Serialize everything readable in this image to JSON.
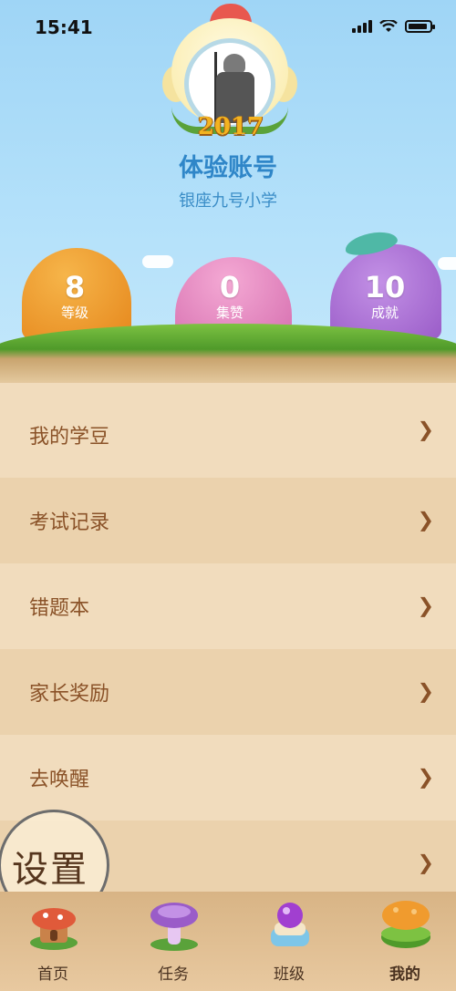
{
  "status_bar": {
    "time": "15:41"
  },
  "profile": {
    "avatar_badge": "2017",
    "username": "体验账号",
    "school": "银座九号小学"
  },
  "stats": [
    {
      "value": "8",
      "label": "等级",
      "color": "#f09b2e"
    },
    {
      "value": "0",
      "label": "集赞",
      "color": "#e48bc0"
    },
    {
      "value": "10",
      "label": "成就",
      "color": "#a86ad0"
    }
  ],
  "menu": {
    "items": [
      {
        "label": "我的学豆"
      },
      {
        "label": "考试记录"
      },
      {
        "label": "错题本"
      },
      {
        "label": "家长奖励"
      },
      {
        "label": "去唤醒"
      },
      {
        "label": "设置"
      }
    ]
  },
  "tabbar": {
    "tabs": [
      {
        "label": "首页",
        "icon": "home-mushroom-house-icon"
      },
      {
        "label": "任务",
        "icon": "task-mushroom-icon"
      },
      {
        "label": "班级",
        "icon": "class-orb-icon"
      },
      {
        "label": "我的",
        "icon": "profile-mushroom-icon",
        "active": true
      }
    ]
  },
  "colors": {
    "accent_blue": "#2f86c8",
    "menu_text": "#8a5228",
    "sky": "#a8dbf7"
  }
}
